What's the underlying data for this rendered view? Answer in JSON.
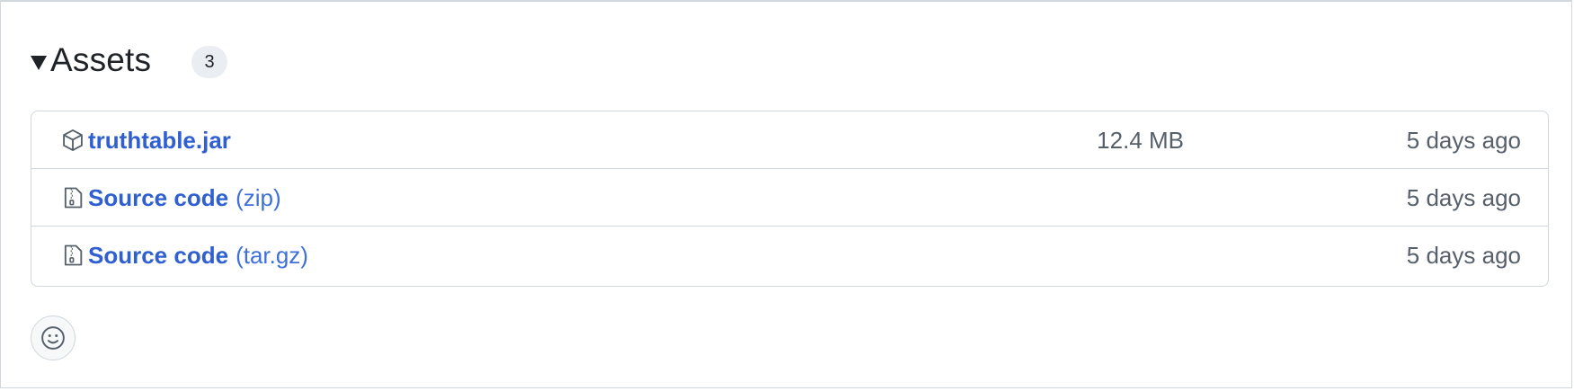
{
  "assets": {
    "title": "Assets",
    "count": "3",
    "items": [
      {
        "icon": "package-icon",
        "name": "truthtable.jar",
        "suffix": "",
        "size": "12.4 MB",
        "date": "5 days ago"
      },
      {
        "icon": "file-zip-icon",
        "name": "Source code",
        "suffix": "(zip)",
        "size": "",
        "date": "5 days ago"
      },
      {
        "icon": "file-zip-icon",
        "name": "Source code",
        "suffix": "(tar.gz)",
        "size": "",
        "date": "5 days ago"
      }
    ]
  },
  "reactions": {
    "icon": "smiley-icon"
  },
  "colors": {
    "link": "#2f5fd0",
    "muted": "#57606a",
    "border": "#d0d7de",
    "badge_bg": "#eaeef2"
  }
}
